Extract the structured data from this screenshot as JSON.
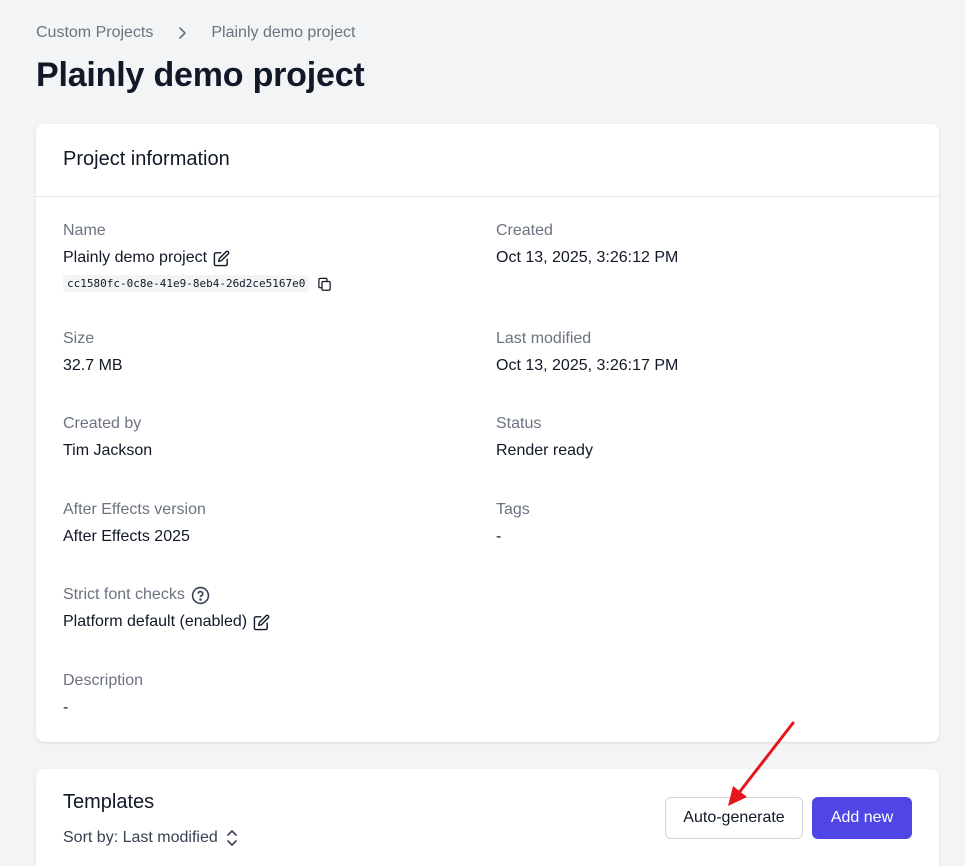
{
  "breadcrumb": {
    "parent": "Custom Projects",
    "current": "Plainly demo project"
  },
  "page": {
    "title": "Plainly demo project"
  },
  "project_info": {
    "heading": "Project information",
    "name": {
      "label": "Name",
      "value": "Plainly demo project",
      "id": "cc1580fc-0c8e-41e9-8eb4-26d2ce5167e0"
    },
    "created": {
      "label": "Created",
      "value": "Oct 13, 2025, 3:26:12 PM"
    },
    "size": {
      "label": "Size",
      "value": "32.7 MB"
    },
    "last_modified": {
      "label": "Last modified",
      "value": "Oct 13, 2025, 3:26:17 PM"
    },
    "created_by": {
      "label": "Created by",
      "value": "Tim Jackson"
    },
    "status": {
      "label": "Status",
      "value": "Render ready"
    },
    "ae_version": {
      "label": "After Effects version",
      "value": "After Effects 2025"
    },
    "tags": {
      "label": "Tags",
      "value": "-"
    },
    "strict_font_checks": {
      "label": "Strict font checks",
      "value": "Platform default (enabled)"
    },
    "description": {
      "label": "Description",
      "value": "-"
    }
  },
  "templates": {
    "heading": "Templates",
    "sort_label": "Sort by: Last modified",
    "auto_generate_label": "Auto-generate",
    "add_new_label": "Add new"
  },
  "icons": [
    "chevron-right-icon",
    "edit-icon",
    "copy-icon",
    "help-circle-icon",
    "sort-icon",
    "annotation-arrow"
  ],
  "colors": {
    "primary": "#4f46e5",
    "annotation": "#e5161b",
    "background": "#f3f4f6"
  }
}
